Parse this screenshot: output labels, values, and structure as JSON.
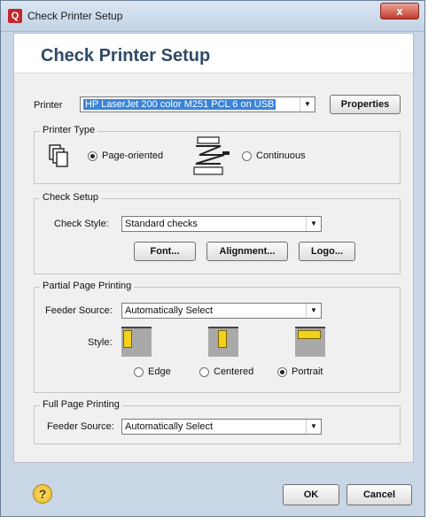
{
  "window": {
    "title": "Check Printer Setup",
    "close_label": "x"
  },
  "dialog": {
    "heading": "Check Printer Setup"
  },
  "printer": {
    "label": "Printer",
    "selected": "HP LaserJet 200 color M251 PCL 6 on USB",
    "properties_button": "Properties"
  },
  "printer_type": {
    "title": "Printer Type",
    "options": [
      {
        "label": "Page-oriented",
        "selected": true
      },
      {
        "label": "Continuous",
        "selected": false
      }
    ]
  },
  "check_setup": {
    "title": "Check Setup",
    "style_label": "Check Style:",
    "style_value": "Standard checks",
    "font_button": "Font...",
    "alignment_button": "Alignment...",
    "logo_button": "Logo..."
  },
  "partial_page": {
    "title": "Partial Page Printing",
    "feeder_label": "Feeder Source:",
    "feeder_value": "Automatically Select",
    "style_label": "Style:",
    "options": [
      {
        "label": "Edge",
        "selected": false
      },
      {
        "label": "Centered",
        "selected": false
      },
      {
        "label": "Portrait",
        "selected": true
      }
    ]
  },
  "full_page": {
    "title": "Full Page Printing",
    "feeder_label": "Feeder Source:",
    "feeder_value": "Automatically Select"
  },
  "footer": {
    "help_label": "?",
    "ok_button": "OK",
    "cancel_button": "Cancel"
  },
  "colors": {
    "heading": "#2f4a68",
    "selection": "#3a84d8",
    "close_button": "#c63b2d",
    "help_icon": "#e8b61a"
  }
}
